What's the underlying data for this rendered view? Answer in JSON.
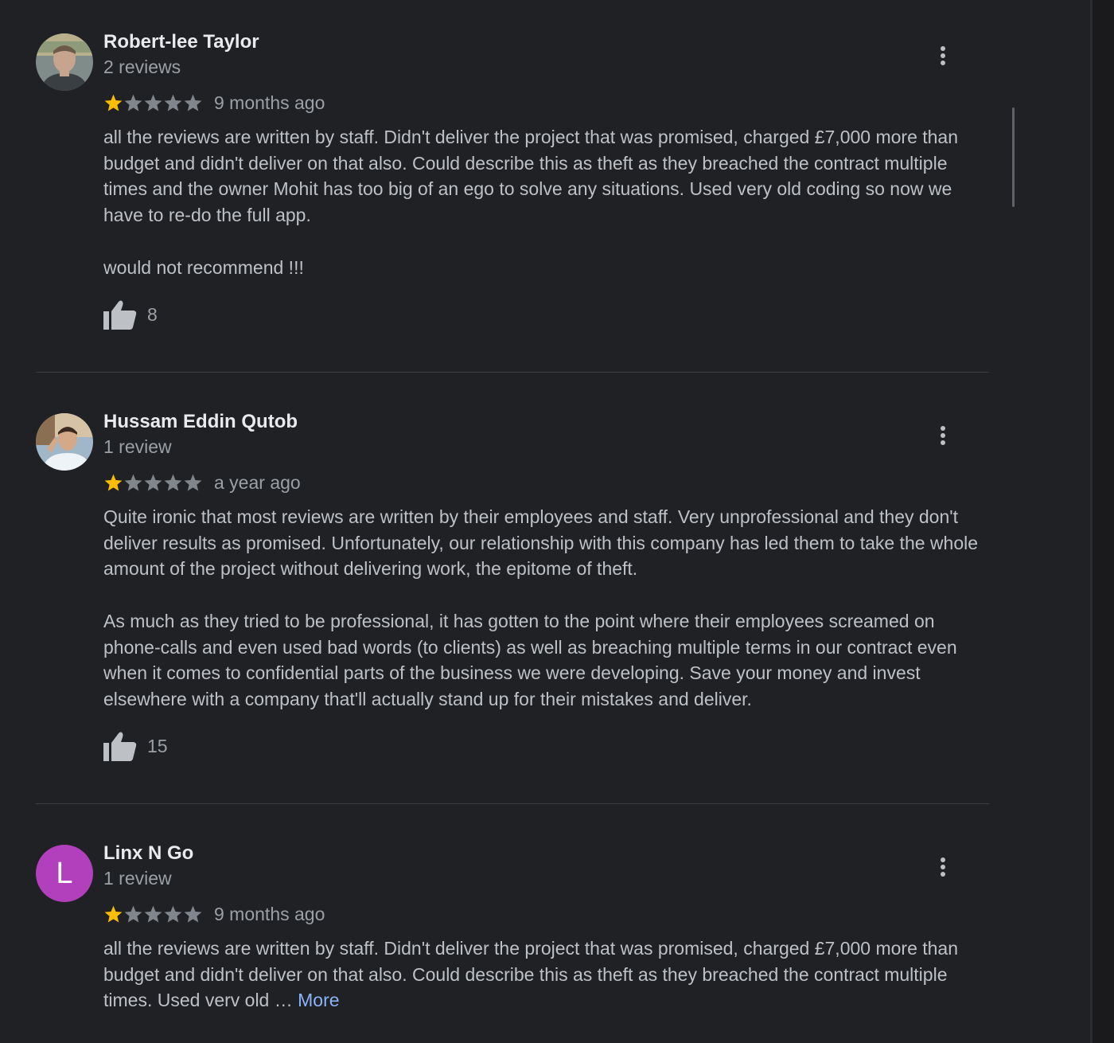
{
  "reviews": [
    {
      "author": "Robert-lee Taylor",
      "review_count": "2 reviews",
      "rating": 1,
      "max_rating": 5,
      "date": "9 months ago",
      "paragraphs": [
        "all the reviews are written by staff. Didn't deliver the project that was promised, charged £7,000 more than budget and didn't deliver on that also. Could describe this as theft as they breached the contract multiple times and the owner Mohit has too big of an ego to solve any situations. Used very old coding so now we have to re-do the full app.",
        "would not recommend !!!"
      ],
      "likes": "8",
      "avatar_type": "photo"
    },
    {
      "author": "Hussam Eddin Qutob",
      "review_count": "1 review",
      "rating": 1,
      "max_rating": 5,
      "date": "a year ago",
      "paragraphs": [
        "Quite ironic that most reviews are written by their employees and staff. Very unprofessional and they don't deliver results as promised. Unfortunately, our relationship with this company has led them to take the whole amount of the project without delivering work, the epitome of theft.",
        "As much as they tried to be professional, it has gotten to the point where their employees screamed on phone-calls and even used bad words (to clients) as well as breaching multiple terms in our contract even when it comes to confidential parts of the business we were developing. Save your money and invest elsewhere with a company that'll actually stand up for their mistakes and deliver."
      ],
      "likes": "15",
      "avatar_type": "photo"
    },
    {
      "author": "Linx N Go",
      "review_count": "1 review",
      "rating": 1,
      "max_rating": 5,
      "date": "9 months ago",
      "truncated_text": "all the reviews are written by staff. Didn't deliver the project that was promised, charged £7,000 more than budget and didn't deliver on that also. Could describe this as theft as they breached the contract multiple times. Used verv old … ",
      "more_label": "More",
      "avatar_letter": "L",
      "avatar_color": "#b240bd"
    }
  ],
  "colors": {
    "background": "#202124",
    "star_filled": "#fbbc04",
    "star_empty": "#80868b",
    "link": "#8ab4f8",
    "divider": "#3c4043"
  },
  "icons": {
    "menu": "more-vert-icon",
    "like": "thumb-up-icon",
    "star": "star-icon"
  }
}
